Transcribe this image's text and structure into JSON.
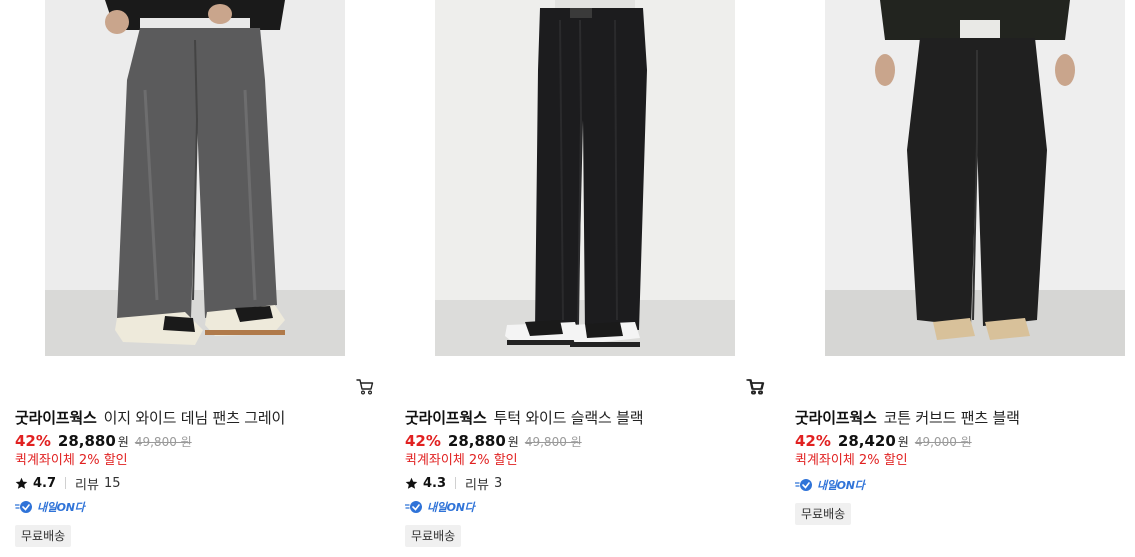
{
  "products": [
    {
      "brand": "굿라이프웍스",
      "name": "이지 와이드 데님 팬츠 그레이",
      "discount": "42%",
      "price": "28,880",
      "currency": "원",
      "original_price": "49,800 원",
      "promo": "퀵계좌이체 2% 할인",
      "rating": "4.7",
      "review_label": "리뷰",
      "review_count": "15",
      "delivery_badge": "내일ON다",
      "shipping_tag": "무료배송",
      "image_icon": "wide-denim-pants-photo",
      "pants_color": "#5b5b5c"
    },
    {
      "brand": "굿라이프웍스",
      "name": "투턱 와이드 슬랙스 블랙",
      "discount": "42%",
      "price": "28,880",
      "currency": "원",
      "original_price": "49,800 원",
      "promo": "퀵계좌이체 2% 할인",
      "rating": "4.3",
      "review_label": "리뷰",
      "review_count": "3",
      "delivery_badge": "내일ON다",
      "shipping_tag": "무료배송",
      "image_icon": "two-tuck-slacks-photo",
      "pants_color": "#1c1c1e"
    },
    {
      "brand": "굿라이프웍스",
      "name": "코튼 커브드 팬츠 블랙",
      "discount": "42%",
      "price": "28,420",
      "currency": "원",
      "original_price": "49,000 원",
      "promo": "퀵계좌이체 2% 할인",
      "delivery_badge": "내일ON다",
      "shipping_tag": "무료배송",
      "image_icon": "cotton-curved-pants-photo",
      "pants_color": "#202020"
    }
  ],
  "colors": {
    "discount_red": "#e12121",
    "delivery_blue": "#2f73d8",
    "tag_bg": "#f0f0f0"
  }
}
